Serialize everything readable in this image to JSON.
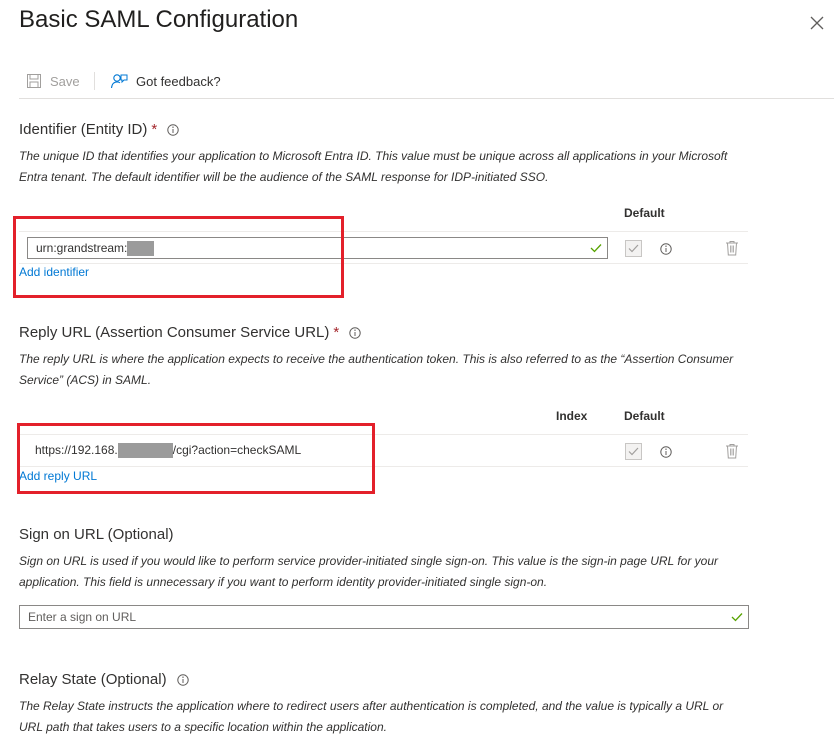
{
  "panel": {
    "title": "Basic SAML Configuration"
  },
  "toolbar": {
    "save_label": "Save",
    "feedback_label": "Got feedback?"
  },
  "identifier": {
    "title": "Identifier (Entity ID)",
    "required": "*",
    "description": "The unique ID that identifies your application to Microsoft Entra ID. This value must be unique across all applications in your Microsoft Entra tenant. The default identifier will be the audience of the SAML response for IDP-initiated SSO.",
    "col_default": "Default",
    "value": "urn:grandstream:",
    "add_label": "Add identifier"
  },
  "reply_url": {
    "title": "Reply URL (Assertion Consumer Service URL)",
    "required": "*",
    "description": "The reply URL is where the application expects to receive the authentication token. This is also referred to as the “Assertion Consumer Service” (ACS) in SAML.",
    "col_index": "Index",
    "col_default": "Default",
    "value_prefix": "https://192.168.",
    "value_suffix": "/cgi?action=checkSAML",
    "add_label": "Add reply URL"
  },
  "sign_on": {
    "title": "Sign on URL (Optional)",
    "description": "Sign on URL is used if you would like to perform service provider-initiated single sign-on. This value is the sign-in page URL for your application. This field is unnecessary if you want to perform identity provider-initiated single sign-on.",
    "placeholder": "Enter a sign on URL"
  },
  "relay_state": {
    "title": "Relay State (Optional)",
    "description": "The Relay State instructs the application where to redirect users after authentication is completed, and the value is typically a URL or URL path that takes users to a specific location within the application."
  },
  "colors": {
    "accent": "#0078d4",
    "valid": "#57a300",
    "required": "#a4262c",
    "highlight": "#e3202a",
    "redaction": "#9b9b9b"
  }
}
